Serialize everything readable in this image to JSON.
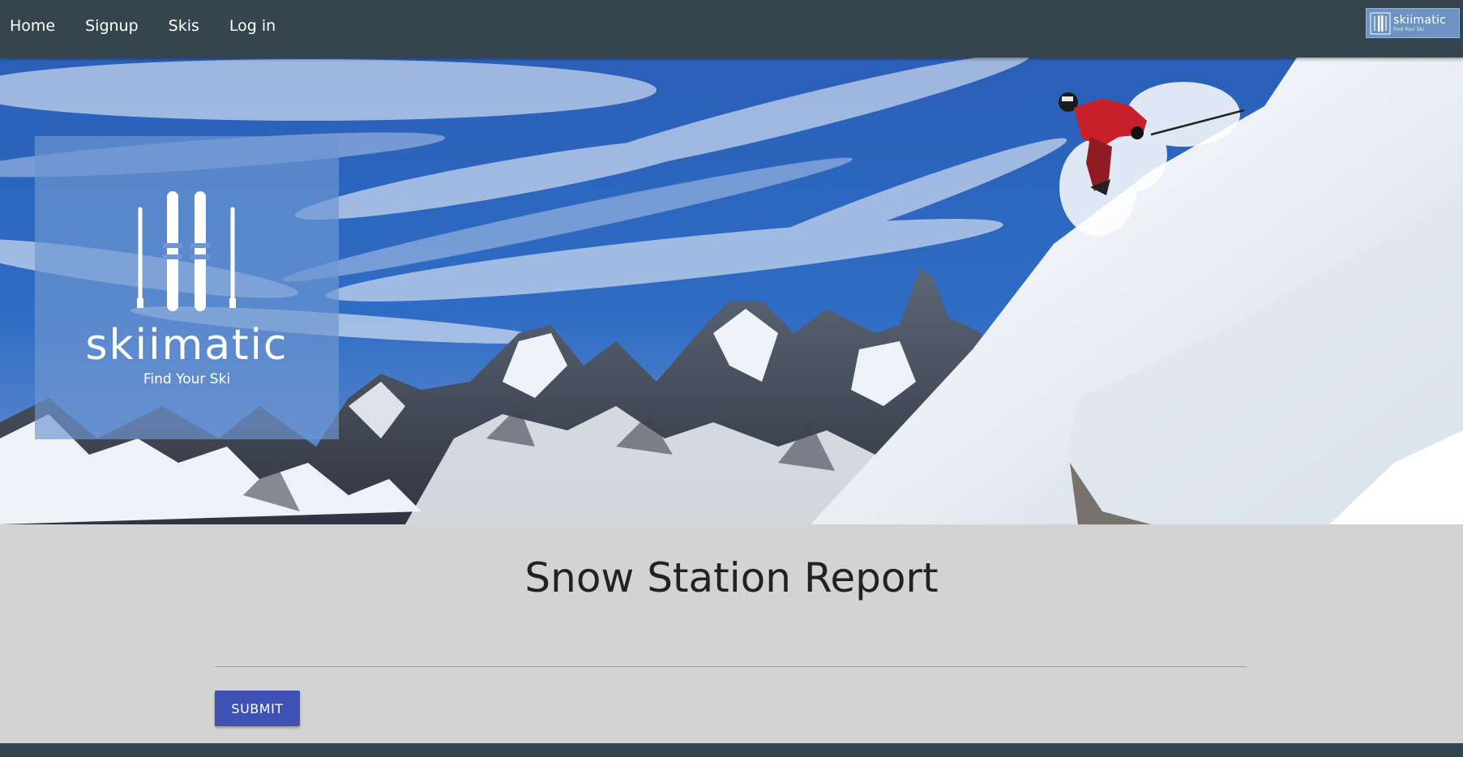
{
  "nav": {
    "links": [
      "Home",
      "Signup",
      "Skis",
      "Log in"
    ],
    "logo": {
      "name": "skiimatic",
      "tagline": "Find Your Ski",
      "icon": "skis-logo-icon"
    }
  },
  "hero": {
    "image": "mountain-skier-photo",
    "logo": {
      "name": "skiimatic",
      "tagline": "Find Your Ski",
      "icon": "skis-logo-icon"
    }
  },
  "main": {
    "title": "Snow Station Report",
    "input": {
      "value": "",
      "placeholder": ""
    },
    "submit_label": "SUBMIT"
  },
  "colors": {
    "navbar": "#36454d",
    "page_background": "#d3d3d3",
    "button": "#3f51b5",
    "logo_panel": "#6e96d2"
  }
}
